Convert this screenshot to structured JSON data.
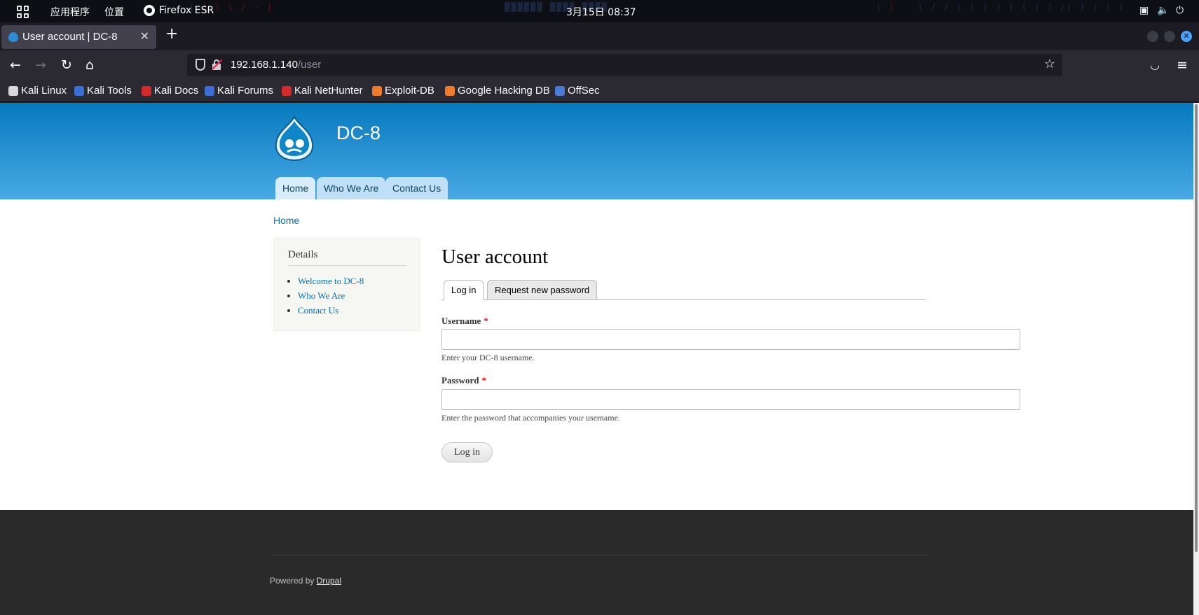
{
  "os": {
    "apps_label": "应用程序",
    "places_label": "位置",
    "active_app": "Firefox ESR",
    "clock": "3月15日  08:37"
  },
  "browser": {
    "tab_title": "User account | DC-8",
    "url_host": "192.168.1.140",
    "url_path": "/user",
    "bookmarks": [
      {
        "label": "Kali Linux",
        "color": "#d8d8d8"
      },
      {
        "label": "Kali Tools",
        "color": "#3a6fd6"
      },
      {
        "label": "Kali Docs",
        "color": "#d42a2a"
      },
      {
        "label": "Kali Forums",
        "color": "#3a6fd6"
      },
      {
        "label": "Kali NetHunter",
        "color": "#d42a2a"
      },
      {
        "label": "Exploit-DB",
        "color": "#f07b2a"
      },
      {
        "label": "Google Hacking DB",
        "color": "#f07b2a"
      },
      {
        "label": "OffSec",
        "color": "#4a7bd6"
      }
    ]
  },
  "site": {
    "name": "DC-8",
    "primary_nav": [
      "Home",
      "Who We Are",
      "Contact Us"
    ],
    "breadcrumb": "Home",
    "sidebar": {
      "title": "Details",
      "links": [
        "Welcome to DC-8",
        "Who We Are",
        "Contact Us"
      ]
    },
    "page_title": "User account",
    "tabs": [
      "Log in",
      "Request new password"
    ],
    "form": {
      "username_label": "Username",
      "username_desc": "Enter your DC-8 username.",
      "password_label": "Password",
      "password_desc": "Enter the password that accompanies your username.",
      "required_marker": "*",
      "submit_label": "Log in"
    },
    "footer": {
      "powered_prefix": "Powered by",
      "powered_link": "Drupal"
    }
  },
  "colors": {
    "header_top": "#0779bf",
    "header_bottom": "#48a9e4",
    "link": "#0071b3",
    "footer_bg": "#2a2a2b"
  }
}
